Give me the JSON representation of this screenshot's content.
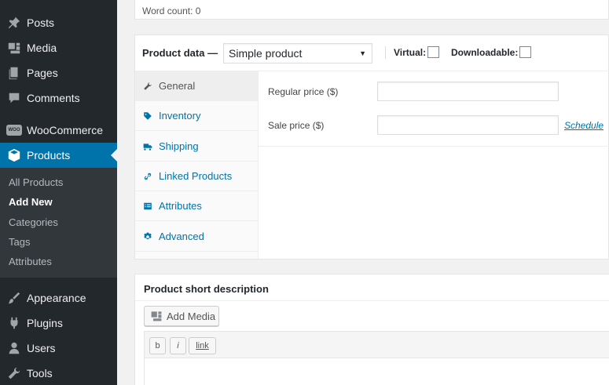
{
  "sidebar": {
    "items": [
      {
        "label": "Posts",
        "icon": "pin-icon"
      },
      {
        "label": "Media",
        "icon": "media-icon"
      },
      {
        "label": "Pages",
        "icon": "pages-icon"
      },
      {
        "label": "Comments",
        "icon": "comment-icon"
      },
      {
        "label": "WooCommerce",
        "icon": "woocommerce-icon"
      },
      {
        "label": "Products",
        "icon": "products-icon"
      },
      {
        "label": "Appearance",
        "icon": "brush-icon"
      },
      {
        "label": "Plugins",
        "icon": "plugin-icon"
      },
      {
        "label": "Users",
        "icon": "user-icon"
      },
      {
        "label": "Tools",
        "icon": "wrench-icon"
      }
    ],
    "woo_badge": "WOO",
    "submenu": [
      "All Products",
      "Add New",
      "Categories",
      "Tags",
      "Attributes"
    ],
    "accent": "#0073aa"
  },
  "word_count": "Word count: 0",
  "product_data": {
    "title": "Product data —",
    "type_selected": "Simple product",
    "virtual_label": "Virtual:",
    "downloadable_label": "Downloadable:",
    "tabs": [
      {
        "label": "General",
        "icon": "wrench-icon"
      },
      {
        "label": "Inventory",
        "icon": "tag-icon"
      },
      {
        "label": "Shipping",
        "icon": "truck-icon"
      },
      {
        "label": "Linked Products",
        "icon": "link-icon"
      },
      {
        "label": "Attributes",
        "icon": "list-icon"
      },
      {
        "label": "Advanced",
        "icon": "gear-icon"
      }
    ],
    "regular_price_label": "Regular price ($)",
    "sale_price_label": "Sale price ($)",
    "schedule_link": "Schedule"
  },
  "short_description": {
    "title": "Product short description",
    "add_media": "Add Media",
    "toolbar": [
      "b",
      "i",
      "link"
    ]
  }
}
